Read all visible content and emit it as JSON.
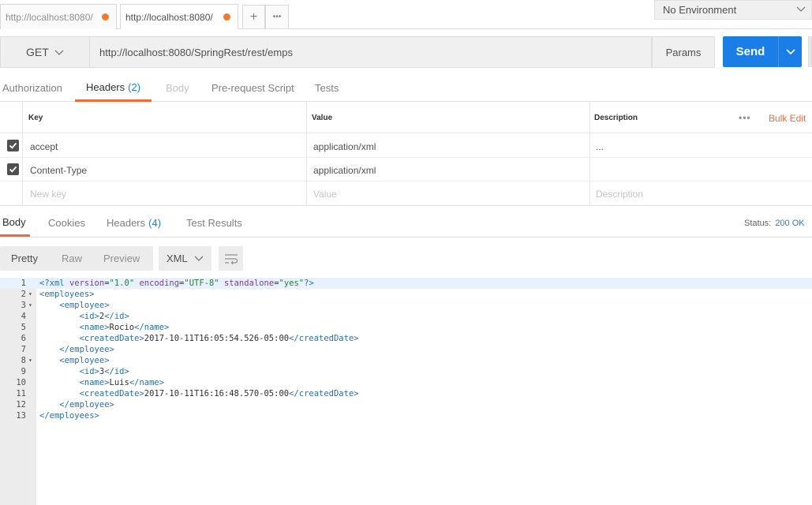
{
  "tabs": [
    {
      "label": "http://localhost:8080/",
      "unsaved": true,
      "active": false
    },
    {
      "label": "http://localhost:8080/",
      "unsaved": true,
      "active": true
    }
  ],
  "tab_controls": {
    "new_tab": "+",
    "more": "•••"
  },
  "environment": {
    "selected": "No Environment"
  },
  "request": {
    "method": "GET",
    "url": "http://localhost:8080/SpringRest/rest/emps",
    "params_label": "Params",
    "send_label": "Send"
  },
  "request_tabs": [
    {
      "label": "Authorization",
      "count": "",
      "state": "normal"
    },
    {
      "label": "Headers",
      "count": "(2)",
      "state": "active"
    },
    {
      "label": "Body",
      "count": "",
      "state": "disabled"
    },
    {
      "label": "Pre-request Script",
      "count": "",
      "state": "normal"
    },
    {
      "label": "Tests",
      "count": "",
      "state": "normal"
    }
  ],
  "headers_table": {
    "columns": {
      "key": "Key",
      "value": "Value",
      "description": "Description"
    },
    "more_label": "•••",
    "bulk_edit": "Bulk Edit",
    "rows": [
      {
        "checked": true,
        "key": "accept",
        "value": "application/xml",
        "description": "..."
      },
      {
        "checked": true,
        "key": "Content-Type",
        "value": "application/xml",
        "description": ""
      }
    ],
    "new_row": {
      "key_placeholder": "New key",
      "value_placeholder": "Value",
      "description_placeholder": "Description"
    }
  },
  "response_tabs": [
    {
      "label": "Body",
      "count": "",
      "state": "active"
    },
    {
      "label": "Cookies",
      "count": "",
      "state": "normal"
    },
    {
      "label": "Headers",
      "count": "(4)",
      "state": "normal"
    },
    {
      "label": "Test Results",
      "count": "",
      "state": "normal"
    }
  ],
  "status": {
    "label": "Status:",
    "value": "200 OK"
  },
  "view_modes": {
    "pretty": "Pretty",
    "raw": "Raw",
    "preview": "Preview",
    "active": "Pretty"
  },
  "format": "XML",
  "code_lines": [
    "<?xml version=\"1.0\" encoding=\"UTF-8\" standalone=\"yes\"?>",
    "<employees>",
    "    <employee>",
    "        <id>2</id>",
    "        <name>Rocio</name>",
    "        <createdDate>2017-10-11T16:05:54.526-05:00</createdDate>",
    "    </employee>",
    "    <employee>",
    "        <id>3</id>",
    "        <name>Luis</name>",
    "        <createdDate>2017-10-11T16:16:48.570-05:00</createdDate>",
    "    </employee>",
    "</employees>"
  ],
  "foldable_lines": [
    2,
    3,
    8
  ],
  "colors": {
    "accent": "#f26b3a",
    "send": "#1a7ee6",
    "unsaved_dot": "#f07a30",
    "link_blue": "#1a7ee6"
  }
}
